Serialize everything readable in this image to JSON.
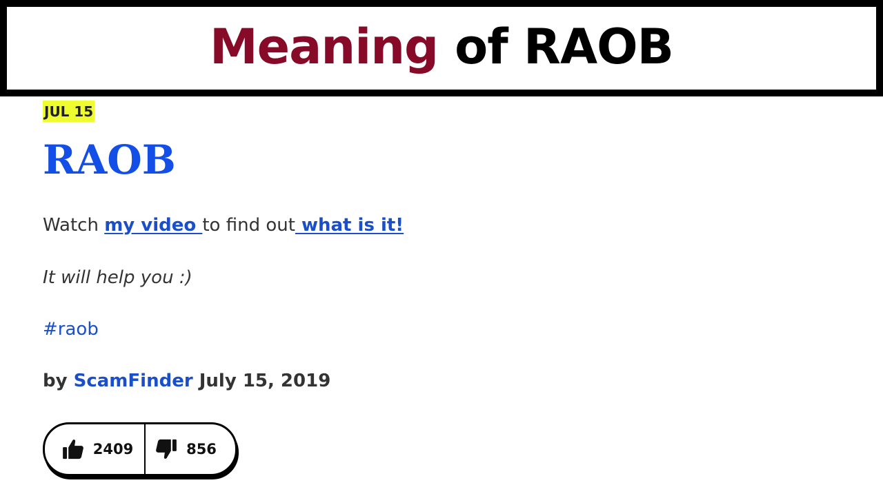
{
  "banner": {
    "title_accent": "Meaning",
    "title_rest": "of RAOB"
  },
  "entry": {
    "date_badge": "JUL 15",
    "word": "RAOB",
    "meaning": {
      "text_1": "Watch ",
      "link_1": "my video ",
      "text_2": "to find out",
      "link_2": " what is it!"
    },
    "example": "It will help you :)",
    "tag": "#raob",
    "author": {
      "prefix": "by",
      "name": "ScamFinder",
      "date": "July 15, 2019"
    },
    "votes": {
      "up_count": "2409",
      "down_count": "856",
      "up_icon": "thumbs-up-icon",
      "down_icon": "thumbs-down-icon"
    }
  },
  "colors": {
    "accent_title": "#870a28",
    "link_blue": "#1a4fc9",
    "word_blue": "#134fe6",
    "badge_yellow": "#effc2f"
  }
}
